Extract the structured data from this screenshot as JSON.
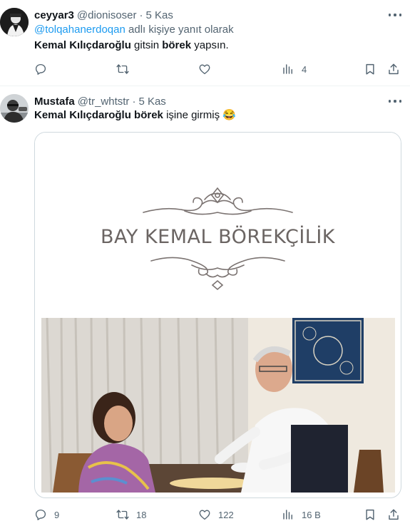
{
  "tweets": [
    {
      "author_name": "ceyyar3",
      "handle": "@dionisoser",
      "separator": "·",
      "date": "5 Kas",
      "reply_mention": "@tolqahanerdoqan",
      "reply_suffix": " adlı kişiye yanıt olarak",
      "text_parts": [
        "Kemal Kılıçdaroğlu",
        " gitsin ",
        "börek",
        " yapsın."
      ],
      "stats": {
        "replies": "",
        "retweets": "",
        "likes": "",
        "views": "4"
      }
    },
    {
      "author_name": "Mustafa",
      "handle": "@tr_whtstr",
      "separator": "·",
      "date": "5 Kas",
      "text_parts": [
        "Kemal Kılıçdaroğlu",
        " ",
        "börek",
        " işine girmiş ",
        "😂"
      ],
      "media": {
        "banner_text": "BAY KEMAL BÖREKÇİLİK"
      },
      "stats": {
        "replies": "9",
        "retweets": "18",
        "likes": "122",
        "views": "16 B"
      }
    }
  ],
  "icons": [
    "more-icon",
    "reply-icon",
    "retweet-icon",
    "like-icon",
    "views-icon",
    "bookmark-icon",
    "share-icon"
  ],
  "colors": {
    "accent": "#1d9bf0",
    "secondary_text": "#536471",
    "primary_text": "#0f1419",
    "border": "#cfd9de",
    "banner_text": "#6b6563"
  }
}
